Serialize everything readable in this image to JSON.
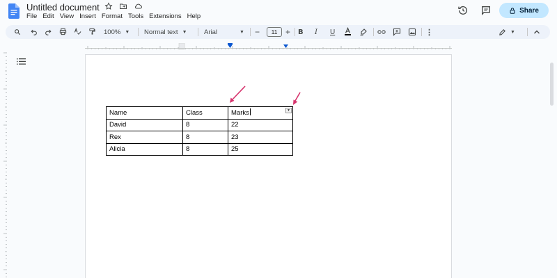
{
  "document": {
    "title": "Untitled document"
  },
  "menu": [
    "File",
    "Edit",
    "View",
    "Insert",
    "Format",
    "Tools",
    "Extensions",
    "Help"
  ],
  "header": {
    "share_label": "Share"
  },
  "toolbar": {
    "zoom": "100%",
    "style": "Normal text",
    "font": "Arial",
    "font_size": "11",
    "minus": "−",
    "plus": "+"
  },
  "table": {
    "rows": [
      [
        "Name",
        "Class",
        "Marks"
      ],
      [
        "David",
        "8",
        "22"
      ],
      [
        "Rex",
        "8",
        "23"
      ],
      [
        "Alicia",
        "8",
        "25"
      ]
    ]
  },
  "colors": {
    "accent": "#0b57d0",
    "share_bg": "#c2e7ff",
    "arrow": "#d6336c"
  }
}
